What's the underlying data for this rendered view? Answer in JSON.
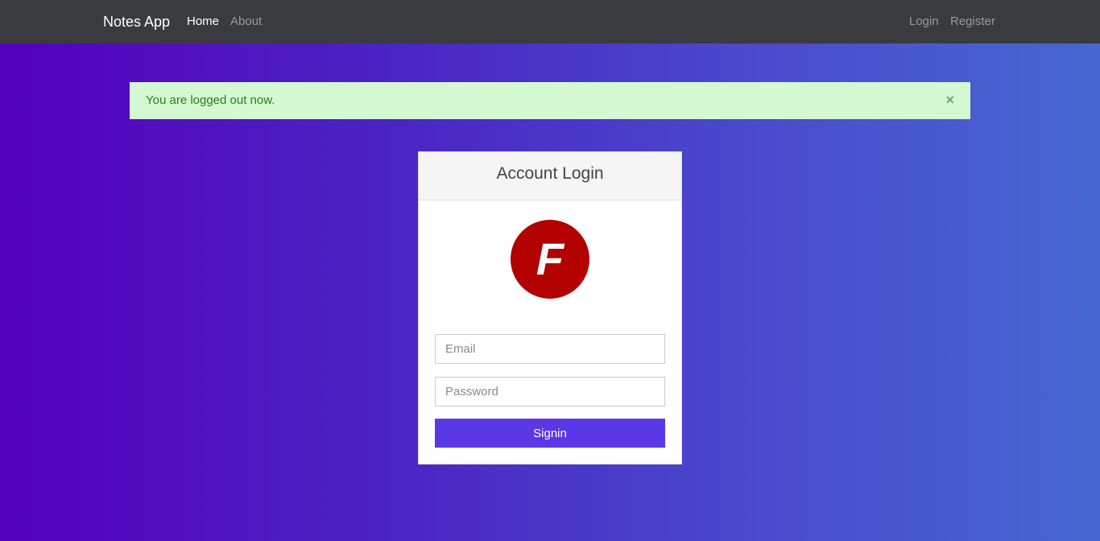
{
  "navbar": {
    "brand": "Notes App",
    "left_links": [
      {
        "label": "Home",
        "active": true
      },
      {
        "label": "About",
        "active": false
      }
    ],
    "right_links": [
      {
        "label": "Login"
      },
      {
        "label": "Register"
      }
    ]
  },
  "alert": {
    "message": "You are logged out now.",
    "close_symbol": "×",
    "close_icon": "close-icon"
  },
  "login_card": {
    "title": "Account Login",
    "logo_letter": "F",
    "logo_color": "#b30000",
    "email_placeholder": "Email",
    "email_value": "",
    "password_placeholder": "Password",
    "password_value": "",
    "submit_label": "Signin"
  },
  "colors": {
    "navbar_bg": "#3a3b3f",
    "alert_bg": "#d4f8d2",
    "alert_text": "#2e7d1a",
    "button_bg": "#5a38e6",
    "background_gradient_start": "#5500bb",
    "background_gradient_end": "#4667d1"
  }
}
